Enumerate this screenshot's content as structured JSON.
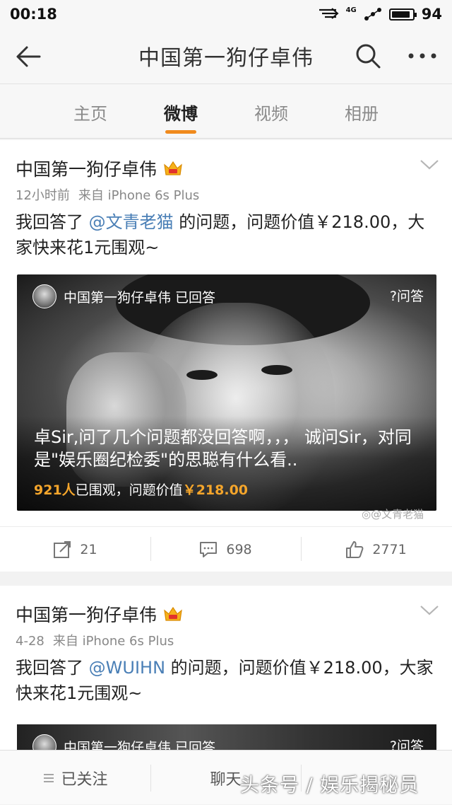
{
  "status": {
    "time": "00:18",
    "network": "4G",
    "battery_level": "94"
  },
  "nav": {
    "title": "中国第一狗仔卓伟"
  },
  "tabs": [
    {
      "label": "主页"
    },
    {
      "label": "微博",
      "active": true
    },
    {
      "label": "视频"
    },
    {
      "label": "相册"
    }
  ],
  "posts": [
    {
      "author": "中国第一狗仔卓伟",
      "time": "12小时前",
      "source": "来自 iPhone 6s Plus",
      "text_prefix": "我回答了 ",
      "mention": "@文青老猫",
      "text_suffix": " 的问题，问题价值￥218.00，大家快来花1元围观~",
      "share": {
        "header": "中国第一狗仔卓伟 已回答",
        "badge": "?问答",
        "question": "卓Sir,问了几个问题都没回答啊，，，  诚问Sir，对同是\"娱乐圈纪检委\"的思聪有什么看..",
        "viewers": "921人",
        "viewers_suffix": "已围观，问题价值",
        "price": "￥218.00"
      },
      "watermark": "@文青老猫",
      "actions": {
        "repost": "21",
        "comment": "698",
        "like": "2771"
      }
    },
    {
      "author": "中国第一狗仔卓伟",
      "time": "4-28",
      "source": "来自 iPhone 6s Plus",
      "text_prefix": "我回答了 ",
      "mention": "@WUIHN",
      "text_suffix": " 的问题，问题价值￥218.00，大家快来花1元围观~",
      "share": {
        "header": "中国第一狗仔卓伟 已回答",
        "badge": "?问答"
      }
    }
  ],
  "bottom": {
    "follow": "已关注",
    "chat": "聊天"
  },
  "overlay_watermark": "头条号 / 娱乐揭秘员"
}
